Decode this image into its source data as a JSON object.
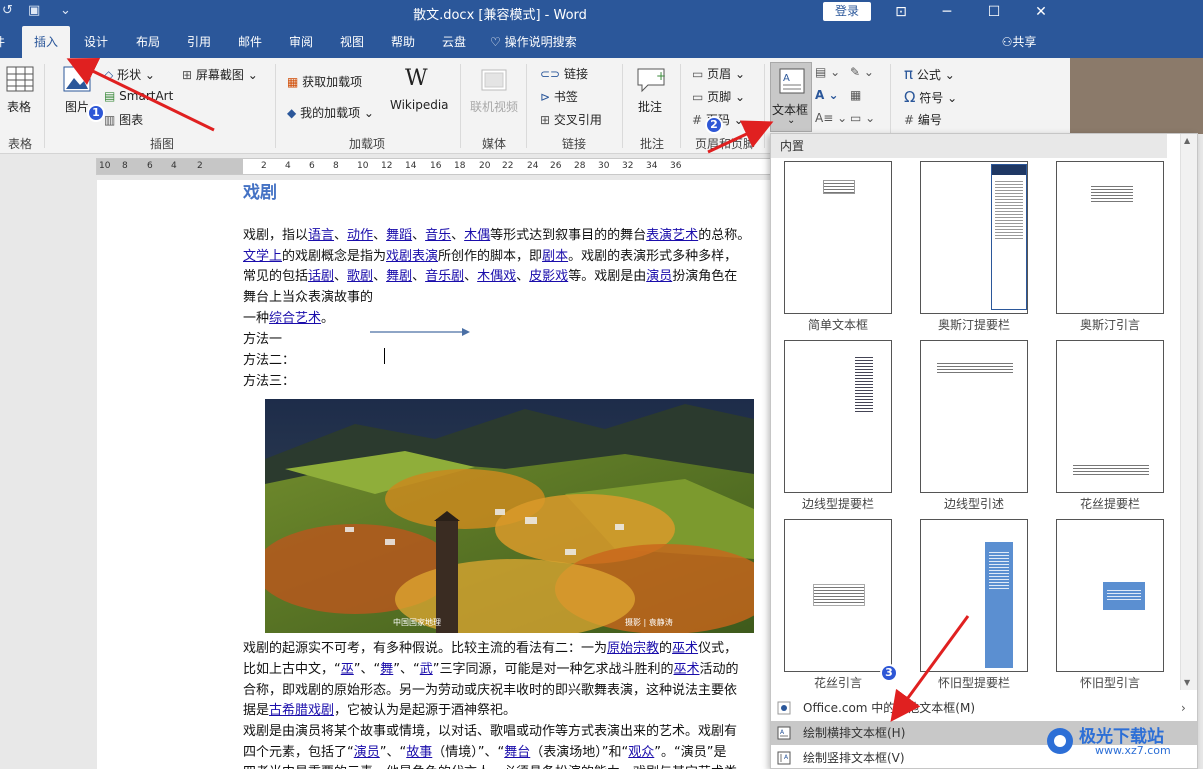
{
  "window": {
    "title": "散文.docx [兼容模式] - Word",
    "login_label": "登录",
    "share_label": "共享"
  },
  "tabs": [
    "插入",
    "设计",
    "布局",
    "引用",
    "邮件",
    "审阅",
    "视图",
    "帮助",
    "云盘"
  ],
  "tell_me": "操作说明搜索",
  "ribbon": {
    "table": {
      "button": "表格",
      "group": "表格"
    },
    "illustrations": {
      "picture": "图片",
      "shapes": "形状",
      "smartart": "SmartArt",
      "chart": "图表",
      "screenshot": "屏幕截图",
      "group": "插图"
    },
    "addins": {
      "get": "获取加载项",
      "mine": "我的加载项",
      "wikipedia": "Wikipedia",
      "group": "加载项"
    },
    "media": {
      "video": "联机视频",
      "group": "媒体"
    },
    "links": {
      "link": "链接",
      "bookmark": "书签",
      "crossref": "交叉引用",
      "group": "链接"
    },
    "comments": {
      "comment": "批注",
      "group": "批注"
    },
    "header_footer": {
      "header": "页眉",
      "footer": "页脚",
      "page_number": "页码",
      "group": "页眉和页脚"
    },
    "text": {
      "textbox": "文本框"
    },
    "symbols": {
      "equation": "公式",
      "symbol": "符号",
      "number": "编号"
    }
  },
  "ruler": [
    "10",
    "8",
    "6",
    "4",
    "2",
    "2",
    "4",
    "6",
    "8",
    "10",
    "12",
    "14",
    "16",
    "18",
    "20",
    "22",
    "24",
    "26",
    "28",
    "30",
    "32",
    "34",
    "36"
  ],
  "document": {
    "heading": "戏剧",
    "line1_parts": [
      "戏剧，指以",
      "语言",
      "、",
      "动作",
      "、",
      "舞蹈",
      "、",
      "音乐",
      "、",
      "木偶",
      "等形式达到叙事目的的舞台",
      "表演艺术",
      "的总称。"
    ],
    "line2_parts": [
      "文学上",
      "的戏剧概念是指为",
      "戏剧表演",
      "所创作的脚本，即",
      "剧本",
      "。戏剧的表演形式多种多样，"
    ],
    "line3_parts": [
      "常见的包括",
      "话剧",
      "、",
      "歌剧",
      "、",
      "舞剧",
      "、",
      "音乐剧",
      "、",
      "木偶戏",
      "、",
      "皮影戏",
      "等。戏剧是由",
      "演员",
      "扮演角色在"
    ],
    "line4": "舞台上当众表演故事的",
    "line5_parts": [
      "一种",
      "综合艺术",
      "。"
    ],
    "method1": "方法一",
    "method2": "方法二：",
    "method3": "方法三：",
    "photo_caption_left": "中国国家地理",
    "photo_caption_mid": "摄影 | 袁静涛",
    "para2_l1_parts": [
      "戏剧的起源实不可考，有多种假说。比较主流的看法有二：一为",
      "原始宗教",
      "的",
      "巫术",
      "仪式，"
    ],
    "para2_l2_parts": [
      "比如上古中文，“",
      "巫",
      "”、“",
      "舞",
      "”、“",
      "武",
      "”三字同源，可能是对一种乞求战斗胜利的",
      "巫术",
      "活动的"
    ],
    "para2_l3": "合称，即戏剧的原始形态。另一为劳动或庆祝丰收时的即兴歌舞表演，这种说法主要依",
    "para2_l4_parts": [
      "据是",
      "古希腊戏剧",
      "，它被认为是起源于酒神祭祀。"
    ],
    "para3_l1": "戏剧是由演员将某个故事或情境，以对话、歌唱或动作等方式表演出来的艺术。戏剧有",
    "para3_l2_parts": [
      "四个元素，包括了“",
      "演员",
      "”、“",
      "故事",
      "（情境）”、“",
      "舞台",
      "（表演场地）”和“",
      "观众",
      "”。“演员”是"
    ],
    "para3_l3": "四者当中最重要的元素，他是角色的代言人，必须具备扮演的能力。戏剧与其它艺术类"
  },
  "gallery": {
    "header": "内置",
    "items": [
      "简单文本框",
      "奥斯汀提要栏",
      "奥斯汀引言",
      "边线型提要栏",
      "边线型引述",
      "花丝提要栏",
      "花丝引言",
      "怀旧型提要栏",
      "怀旧型引言"
    ],
    "menu": [
      "Office.com 中的其他文本框(M)",
      "绘制横排文本框(H)",
      "绘制竖排文本框(V)"
    ]
  },
  "annotations": [
    "1",
    "2",
    "3"
  ],
  "watermark": {
    "brand": "极光下载站",
    "url": "www.xz7.com"
  },
  "colors": {
    "accent": "#2b579a",
    "badge": "#2e57d6",
    "arrow": "#e02020",
    "link": "#1a0dab"
  }
}
